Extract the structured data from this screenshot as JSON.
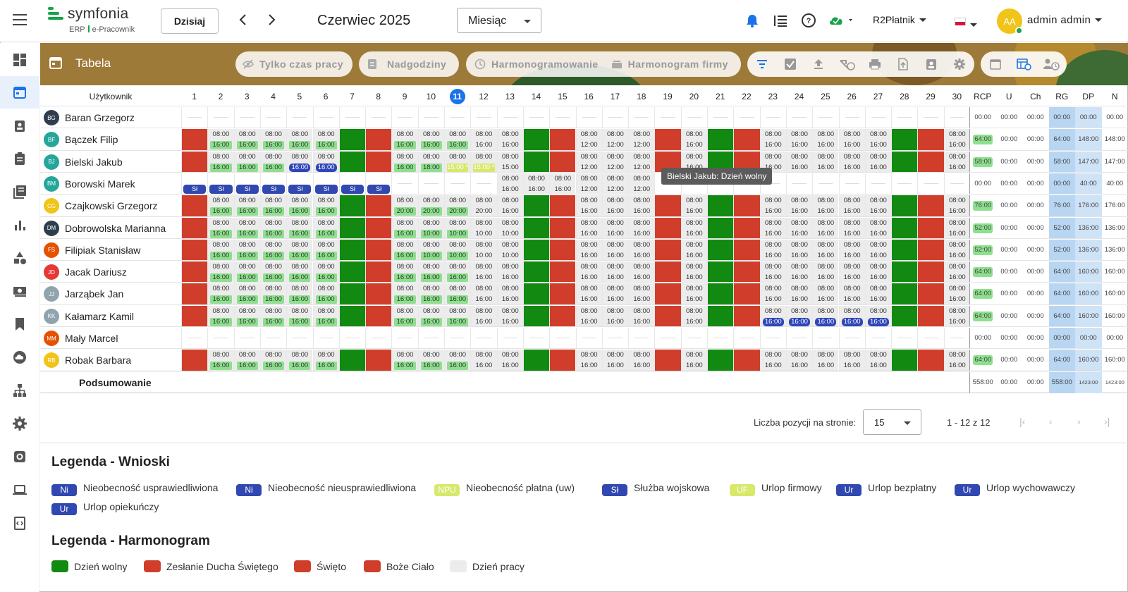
{
  "header": {
    "brand_name": "symfonia",
    "brand_sub_left": "ERP",
    "brand_sub_right": "e-Pracownik",
    "today_label": "Dzisiaj",
    "prev_icon": "chevron-left-icon",
    "next_icon": "chevron-right-icon",
    "period_title": "Czerwiec 2025",
    "view_select_value": "Miesiąc",
    "company_name": "R2Płatnik",
    "user_initials": "AA",
    "user_name": "admin admin",
    "colors": {
      "brand_green": "#17a34a",
      "accent_blue": "#1a73e8"
    }
  },
  "section": {
    "title": "Tabela",
    "pills": [
      {
        "label": "Tylko czas pracy",
        "icon": "eye-off-icon"
      },
      {
        "label": "Nadgodziny",
        "icon": "document-icon"
      },
      {
        "label": "Harmonogramowanie",
        "icon": "clock-icon"
      },
      {
        "label": "Harmonogram firmy",
        "icon": "stack-icon"
      }
    ]
  },
  "table": {
    "user_col": "Użytkownik",
    "today": "11",
    "days": [
      "1",
      "2",
      "3",
      "4",
      "5",
      "6",
      "7",
      "8",
      "9",
      "10",
      "11",
      "12",
      "13",
      "14",
      "15",
      "16",
      "17",
      "18",
      "19",
      "20",
      "21",
      "22",
      "23",
      "24",
      "25",
      "26",
      "27",
      "28",
      "29",
      "30"
    ],
    "sum_cols": [
      "RCP",
      "U",
      "Ch",
      "RG",
      "DP",
      "N"
    ],
    "rows": [
      {
        "initials": "BG",
        "name": "Baran Grzegorz",
        "color": "#2f3e4e",
        "pattern": "empty",
        "sums": [
          "00:00",
          "00:00",
          "00:00",
          "00:00",
          "00:00",
          "00:00"
        ],
        "rcp_badge": false
      },
      {
        "initials": "BF",
        "name": "Bączek Filip",
        "color": "#26a69a",
        "pattern": "filip",
        "sums": [
          "64:00",
          "00:00",
          "00:00",
          "64:00",
          "148:00",
          "148:00"
        ],
        "rcp_badge": true
      },
      {
        "initials": "BJ",
        "name": "Bielski Jakub",
        "color": "#26a69a",
        "pattern": "jakub",
        "sums": [
          "58:00",
          "00:00",
          "00:00",
          "58:00",
          "147:00",
          "147:00"
        ],
        "rcp_badge": true
      },
      {
        "initials": "BM",
        "name": "Borowski Marek",
        "color": "#26a69a",
        "pattern": "marek",
        "sums": [
          "00:00",
          "00:00",
          "00:00",
          "00:00",
          "40:00",
          "40:00"
        ],
        "rcp_badge": false
      },
      {
        "initials": "CG",
        "name": "Czajkowski Grzegorz",
        "color": "#f0c419",
        "pattern": "czaj",
        "sums": [
          "76:00",
          "00:00",
          "00:00",
          "76:00",
          "176:00",
          "176:00"
        ],
        "rcp_badge": true
      },
      {
        "initials": "DM",
        "name": "Dobrowolska Marianna",
        "color": "#2f3e4e",
        "pattern": "dobro",
        "sums": [
          "52:00",
          "00:00",
          "00:00",
          "52:00",
          "136:00",
          "136:00"
        ],
        "rcp_badge": true
      },
      {
        "initials": "FS",
        "name": "Filipiak Stanisław",
        "color": "#e65100",
        "pattern": "dobro",
        "sums": [
          "52:00",
          "00:00",
          "00:00",
          "52:00",
          "136:00",
          "136:00"
        ],
        "rcp_badge": true
      },
      {
        "initials": "JD",
        "name": "Jacak Dariusz",
        "color": "#e53935",
        "pattern": "std",
        "sums": [
          "64:00",
          "00:00",
          "00:00",
          "64:00",
          "160:00",
          "160:00"
        ],
        "rcp_badge": true
      },
      {
        "initials": "JJ",
        "name": "Jarząbek Jan",
        "color": "#90a4ae",
        "pattern": "std",
        "sums": [
          "64:00",
          "00:00",
          "00:00",
          "64:00",
          "160:00",
          "160:00"
        ],
        "rcp_badge": true
      },
      {
        "initials": "KK",
        "name": "Kałamarz Kamil",
        "color": "#90a4ae",
        "pattern": "kamil",
        "sums": [
          "64:00",
          "00:00",
          "00:00",
          "64:00",
          "160:00",
          "160:00"
        ],
        "rcp_badge": true
      },
      {
        "initials": "MM",
        "name": "Mały Marcel",
        "color": "#e65100",
        "pattern": "empty",
        "sums": [
          "00:00",
          "00:00",
          "00:00",
          "00:00",
          "00:00",
          "00:00"
        ],
        "rcp_badge": false
      },
      {
        "initials": "RB",
        "name": "Robak Barbara",
        "color": "#f0c419",
        "pattern": "std",
        "sums": [
          "64:00",
          "00:00",
          "00:00",
          "64:00",
          "160:00",
          "160:00"
        ],
        "rcp_badge": true
      }
    ],
    "summary_label": "Podsumowanie",
    "summary_sums": [
      "558:00",
      "00:00",
      "00:00",
      "558:00",
      "1423:00",
      "1423:00"
    ],
    "tooltip": "Bielski Jakub: Dzień wolny",
    "time_start": "08:00",
    "time_end": "16:00"
  },
  "pagination": {
    "per_page_label": "Liczba pozycji na stronie:",
    "per_page_value": "15",
    "range_text": "1 - 12 z 12"
  },
  "legend_requests": {
    "title": "Legenda - Wnioski",
    "items": [
      {
        "chip": "Ni",
        "label": "Nieobecność usprawiedliwiona",
        "color": "#3048b0"
      },
      {
        "chip": "Ni",
        "label": "Nieobecność nieusprawiedliwiona",
        "color": "#3048b0"
      },
      {
        "chip": "NPU",
        "label": "Nieobecność płatna (uw)",
        "color": "#d8e86a"
      },
      {
        "chip": "Sł",
        "label": "Służba wojskowa",
        "color": "#3048b0"
      },
      {
        "chip": "UF",
        "label": "Urlop firmowy",
        "color": "#d8e86a"
      },
      {
        "chip": "Ur",
        "label": "Urlop bezpłatny",
        "color": "#3048b0"
      },
      {
        "chip": "Ur",
        "label": "Urlop wychowawczy",
        "color": "#3048b0"
      },
      {
        "chip": "Ur",
        "label": "Urlop opiekuńczy",
        "color": "#3048b0"
      }
    ]
  },
  "legend_schedule": {
    "title": "Legenda - Harmonogram",
    "items": [
      {
        "label": "Dzień wolny",
        "color": "#128a12"
      },
      {
        "label": "Zesłanie Ducha Świętego",
        "color": "#d03e2b"
      },
      {
        "label": "Święto",
        "color": "#d03e2b"
      },
      {
        "label": "Boże Ciało",
        "color": "#d03e2b"
      },
      {
        "label": "Dzień pracy",
        "color": "#ececec"
      }
    ]
  }
}
